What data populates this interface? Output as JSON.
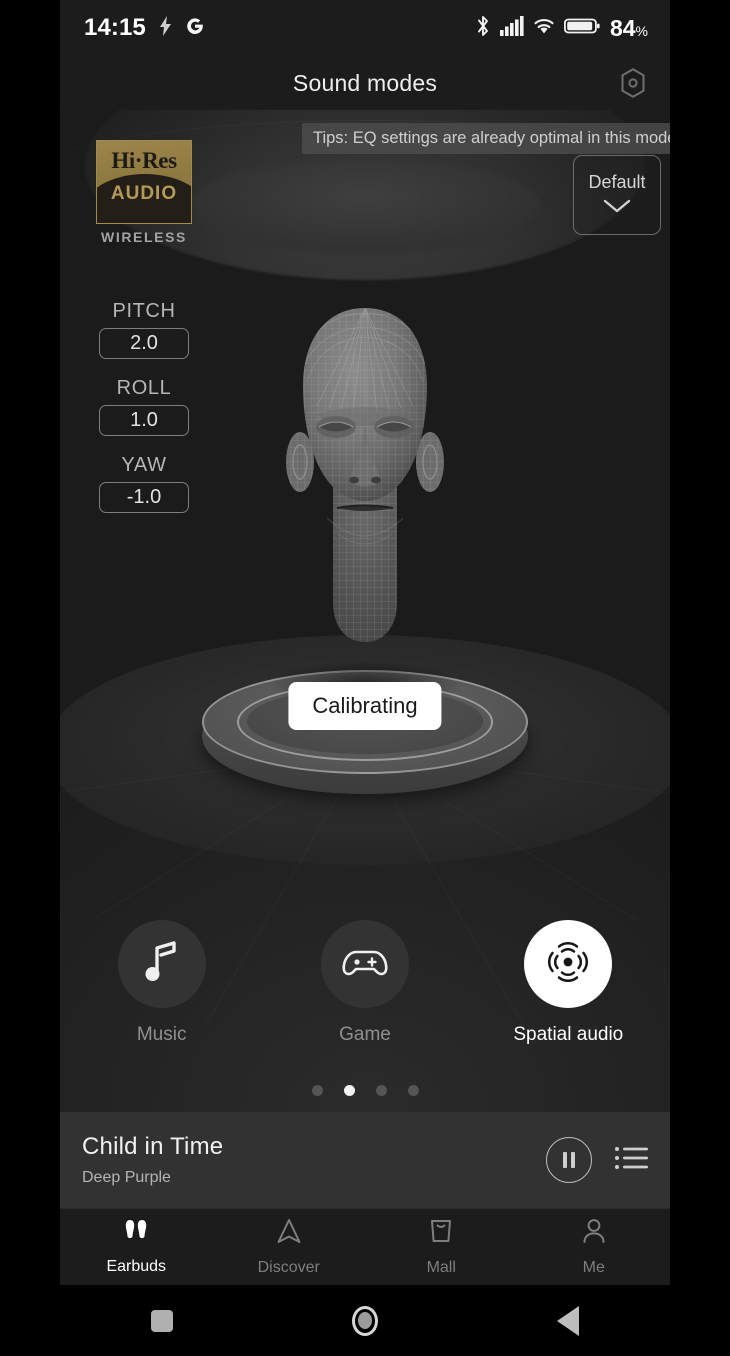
{
  "status_bar": {
    "time": "14:15",
    "battery_percent": "84",
    "battery_unit": "%",
    "icons": [
      "flash-icon",
      "google-icon",
      "bluetooth-icon",
      "cellular-signal-icon",
      "wifi-icon",
      "battery-icon"
    ]
  },
  "header": {
    "title": "Sound modes",
    "action_icon": "hexagon-settings-icon"
  },
  "stage": {
    "hires_badge": {
      "line1": "Hi·Res",
      "line2": "AUDIO",
      "line3": "WIRELESS"
    },
    "tips": "Tips: EQ settings are already optimal in this mode.",
    "preset": {
      "label": "Default",
      "chevron": "chevron-down-icon"
    },
    "axes": [
      {
        "label": "PITCH",
        "value": "2.0"
      },
      {
        "label": "ROLL",
        "value": "1.0"
      },
      {
        "label": "YAW",
        "value": "-1.0"
      }
    ],
    "calibrating_label": "Calibrating",
    "head_model": "3d-wireframe-head"
  },
  "modes": [
    {
      "label": "Music",
      "icon": "music-note-icon",
      "active": false
    },
    {
      "label": "Game",
      "icon": "gamepad-icon",
      "active": false
    },
    {
      "label": "Spatial audio",
      "icon": "spatial-audio-icon",
      "active": true
    }
  ],
  "pagination": {
    "count": 4,
    "active_index": 1
  },
  "player": {
    "title": "Child in Time",
    "artist": "Deep Purple",
    "pause_icon": "pause-circle-icon",
    "playlist_icon": "playlist-icon"
  },
  "bottom_nav": [
    {
      "label": "Earbuds",
      "icon": "earbuds-icon",
      "active": true
    },
    {
      "label": "Discover",
      "icon": "compass-icon",
      "active": false
    },
    {
      "label": "Mall",
      "icon": "shopping-bag-icon",
      "active": false
    },
    {
      "label": "Me",
      "icon": "person-icon",
      "active": false
    }
  ],
  "system_nav": [
    {
      "icon": "recents-square-icon"
    },
    {
      "icon": "home-circle-icon"
    },
    {
      "icon": "back-triangle-icon"
    }
  ],
  "colors": {
    "background": "#1f1f1f",
    "header_bg": "#1c1c1c",
    "player_bg": "#323232",
    "accent_white": "#ffffff",
    "hires_gold": "#8d7840",
    "muted_text": "#8f8f8f"
  }
}
